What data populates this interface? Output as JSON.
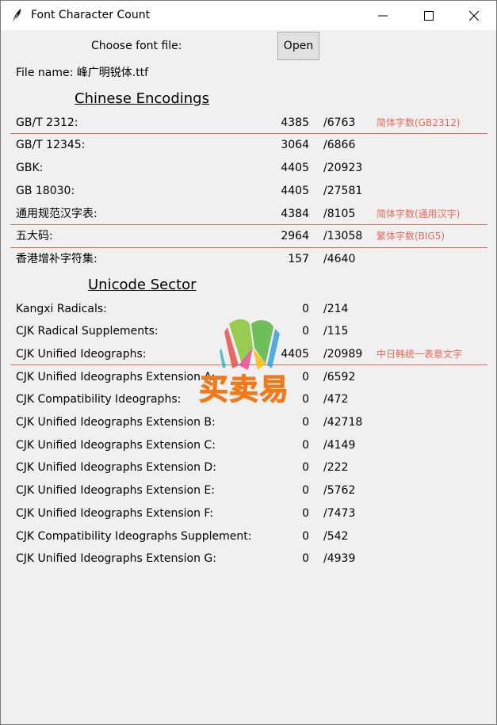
{
  "window": {
    "title": "Font Character Count"
  },
  "colors": {
    "note": "#e36b5a",
    "separator": "#e36b5a"
  },
  "file_picker": {
    "label": "Choose font file:",
    "open_label": "Open"
  },
  "file_name": "File name: 峰广明锐体.ttf",
  "sections": [
    {
      "heading": "Chinese Encodings",
      "rows": [
        {
          "label": "GB/T 2312:",
          "count": "4385",
          "total": "/6763",
          "note": "简体字数(GB2312)"
        },
        {
          "label": "GB/T 12345:",
          "count": "3064",
          "total": "/6866",
          "note": ""
        },
        {
          "label": "GBK:",
          "count": "4405",
          "total": "/20923",
          "note": ""
        },
        {
          "label": "GB 18030:",
          "count": "4405",
          "total": "/27581",
          "note": ""
        },
        {
          "label": "通用规范汉字表:",
          "count": "4384",
          "total": "/8105",
          "note": "简体字数(通用汉字)"
        },
        {
          "label": "五大码:",
          "count": "2964",
          "total": "/13058",
          "note": "繁体字数(BIG5)"
        },
        {
          "label": "香港增补字符集:",
          "count": "157",
          "total": "/4640",
          "note": ""
        }
      ]
    },
    {
      "heading": "Unicode Sector",
      "rows": [
        {
          "label": "Kangxi Radicals:",
          "count": "0",
          "total": "/214",
          "note": ""
        },
        {
          "label": "CJK Radical Supplements:",
          "count": "0",
          "total": "/115",
          "note": ""
        },
        {
          "label": "CJK Unified Ideographs:",
          "count": "4405",
          "total": "/20989",
          "note": "中日韩统一表意文字"
        },
        {
          "label": "CJK Unified Ideographs Extension A:",
          "count": "0",
          "total": "/6592",
          "note": ""
        },
        {
          "label": "CJK Compatibility Ideographs:",
          "count": "0",
          "total": "/472",
          "note": ""
        },
        {
          "label": "CJK Unified Ideographs Extension B:",
          "count": "0",
          "total": "/42718",
          "note": ""
        },
        {
          "label": "CJK Unified Ideographs Extension C:",
          "count": "0",
          "total": "/4149",
          "note": ""
        },
        {
          "label": "CJK Unified Ideographs Extension D:",
          "count": "0",
          "total": "/222",
          "note": ""
        },
        {
          "label": "CJK Unified Ideographs Extension E:",
          "count": "0",
          "total": "/5762",
          "note": ""
        },
        {
          "label": "CJK Unified Ideographs Extension F:",
          "count": "0",
          "total": "/7473",
          "note": ""
        },
        {
          "label": "CJK Compatibility Ideographs Supplement:",
          "count": "0",
          "total": "/542",
          "note": ""
        },
        {
          "label": "CJK Unified Ideographs Extension G:",
          "count": "0",
          "total": "/4939",
          "note": ""
        }
      ]
    }
  ],
  "watermark": {
    "text": "买卖易"
  }
}
